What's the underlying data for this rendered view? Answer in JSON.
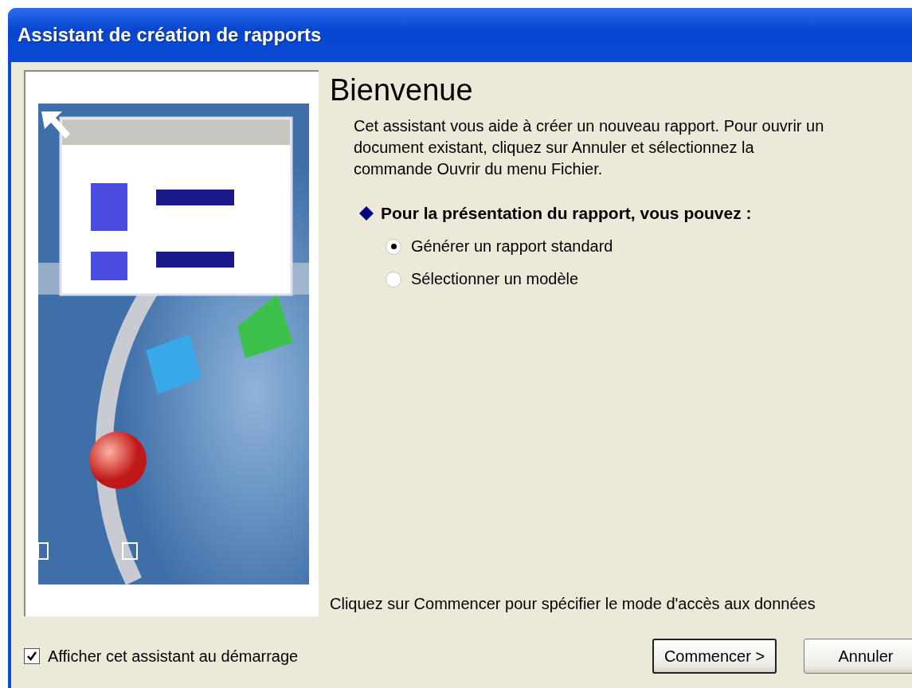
{
  "window": {
    "title": "Assistant de création de rapports"
  },
  "heading": "Bienvenue",
  "intro": "Cet assistant vous aide à créer un nouveau rapport. Pour ouvrir un document existant, cliquez sur Annuler et sélectionnez la commande Ouvrir du menu Fichier.",
  "options_label": "Pour la présentation du rapport, vous pouvez :",
  "options": [
    {
      "label": "Générer un rapport standard",
      "selected": true
    },
    {
      "label": "Sélectionner un modèle",
      "selected": false
    }
  ],
  "hint": "Cliquez sur Commencer pour spécifier le mode d'accès aux données",
  "startup_checkbox": {
    "label": "Afficher cet assistant au démarrage",
    "checked": true
  },
  "buttons": [
    {
      "label": "Commencer >",
      "default": true
    },
    {
      "label": "Annuler",
      "default": false
    }
  ]
}
